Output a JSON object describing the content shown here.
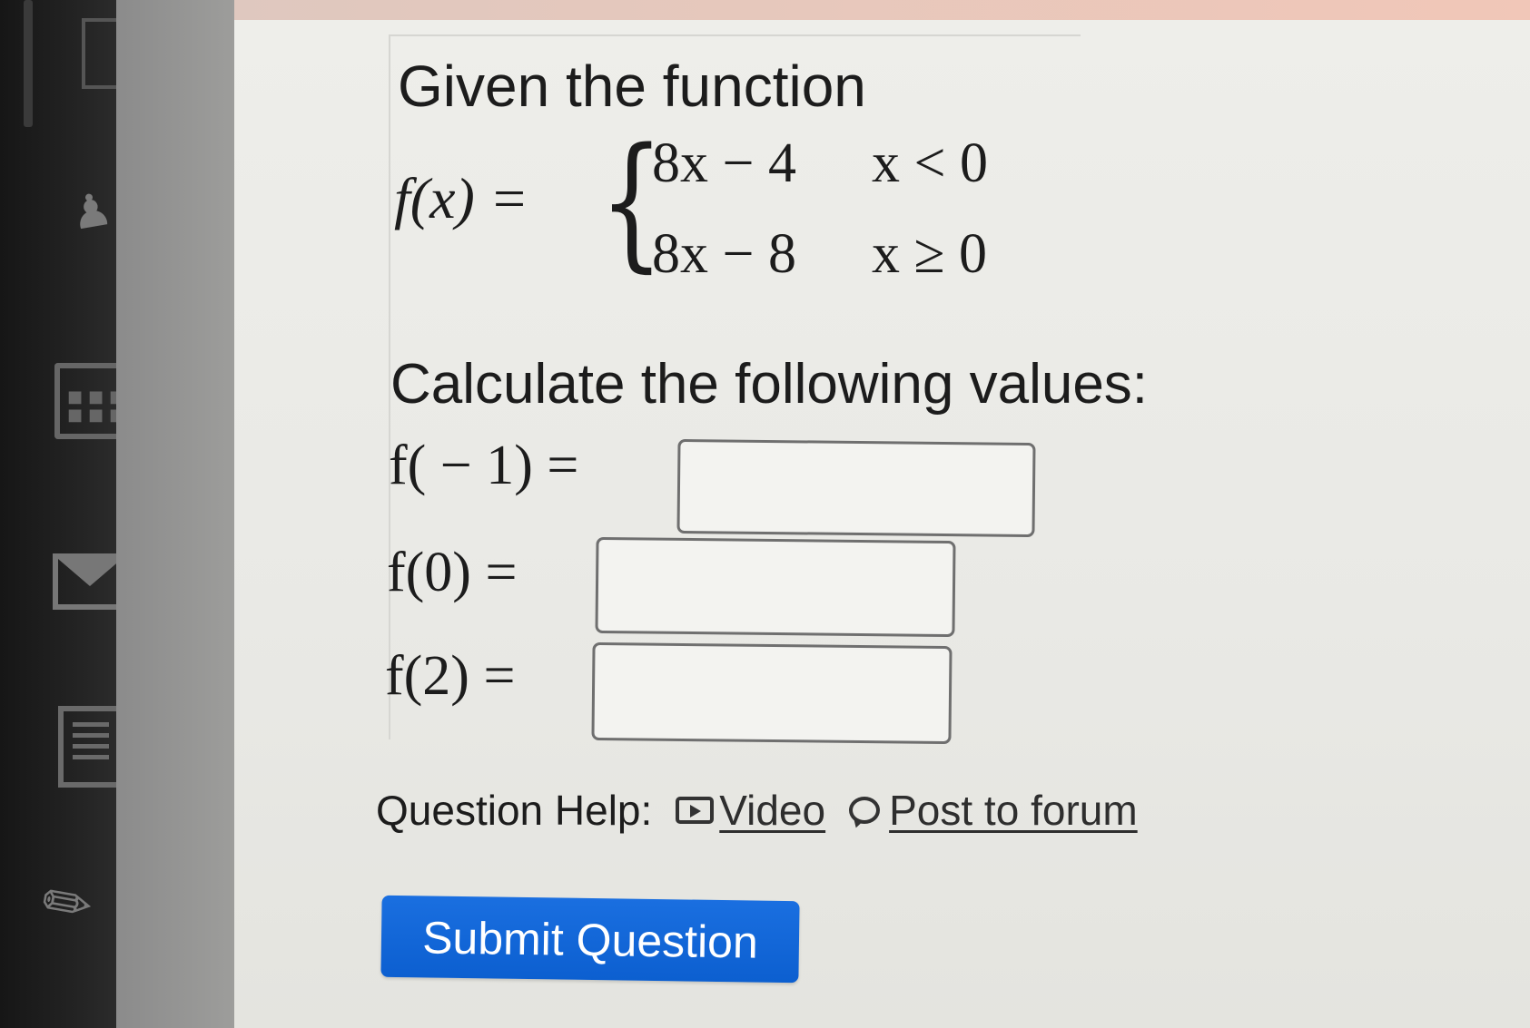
{
  "question": {
    "intro": "Given the function",
    "function_lhs": "f(x) =",
    "cases": [
      {
        "expr": "8x − 4",
        "cond": "x < 0"
      },
      {
        "expr": "8x − 8",
        "cond": "x ≥ 0"
      }
    ],
    "prompt": "Calculate the following values:",
    "evaluations": [
      {
        "label": "f( − 1) =",
        "value": ""
      },
      {
        "label": "f(0) =",
        "value": ""
      },
      {
        "label": "f(2) =",
        "value": ""
      }
    ]
  },
  "help": {
    "label": "Question Help:",
    "video_label": "Video",
    "forum_label": "Post to forum"
  },
  "submit_label": "Submit Question",
  "colors": {
    "submit_button": "#0c5fd0",
    "sidebar": "#1c1c1c"
  }
}
